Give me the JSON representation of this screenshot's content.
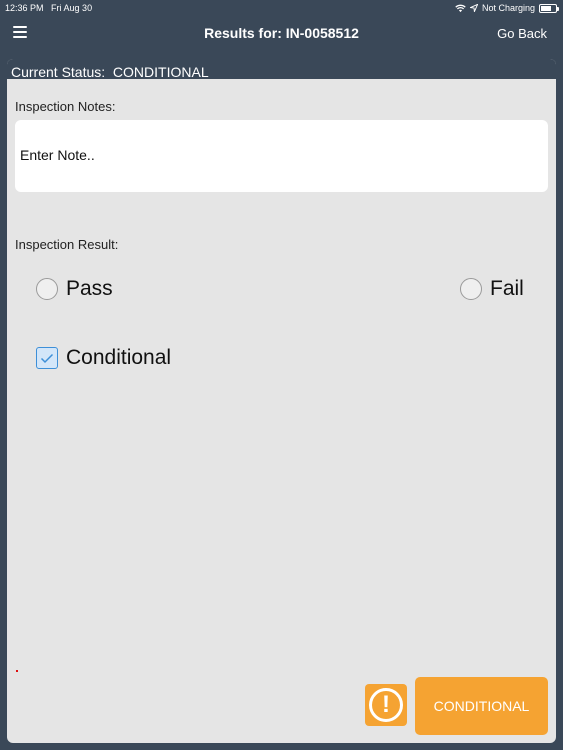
{
  "status_bar": {
    "time": "12:36 PM",
    "date": "Fri Aug 30",
    "charging_text": "Not Charging",
    "battery_level_percent": 70,
    "icons": [
      "wifi-icon",
      "location-arrow-icon",
      "battery-icon"
    ]
  },
  "nav": {
    "title": "Results for: IN-0058512",
    "back_label": "Go Back",
    "menu_icon": "hamburger-menu-icon"
  },
  "panel": {
    "header": "Current Status:  CONDITIONAL",
    "notes_label": "Inspection Notes:",
    "notes_placeholder": "Enter Note..",
    "result_label": "Inspection Result:",
    "options": [
      {
        "label": "Pass",
        "selected": false
      },
      {
        "label": "Fail",
        "selected": false
      },
      {
        "label": "Conditional",
        "selected": true
      }
    ],
    "alert_icon": "exclamation-circle-icon",
    "status_button_label": "CONDITIONAL"
  },
  "colors": {
    "nav_bg": "#3a4858",
    "panel_bg": "#e5e5e5",
    "accent_orange": "#f5a332",
    "checkbox_blue": "#3d8fd8"
  }
}
